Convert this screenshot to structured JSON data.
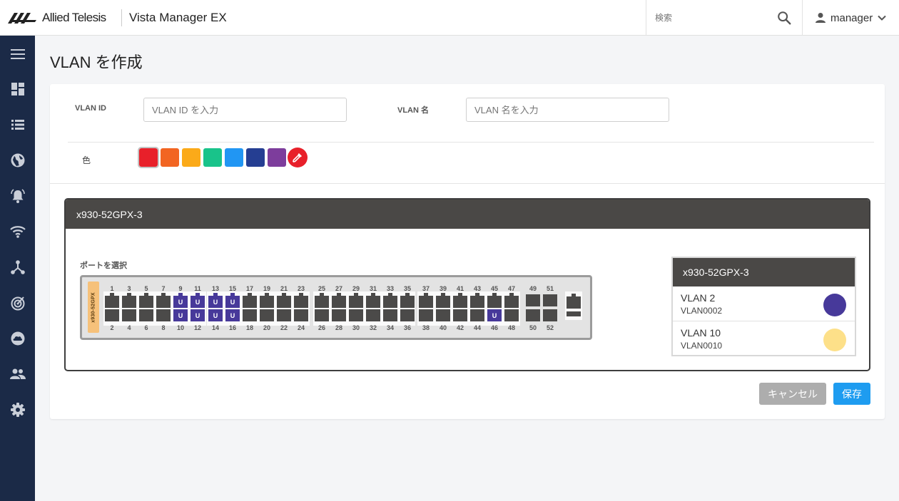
{
  "header": {
    "brand": "Allied Telesis",
    "app_title": "Vista Manager EX",
    "search_placeholder": "検索",
    "user": "manager"
  },
  "sidebar": {
    "items": [
      {
        "icon": "menu-icon"
      },
      {
        "icon": "dashboard-icon"
      },
      {
        "icon": "list-icon"
      },
      {
        "icon": "globe-icon"
      },
      {
        "icon": "alarm-icon"
      },
      {
        "icon": "wifi-icon"
      },
      {
        "icon": "topology-icon"
      },
      {
        "icon": "radar-icon"
      },
      {
        "icon": "cloud-icon"
      },
      {
        "icon": "users-icon"
      },
      {
        "icon": "gear-icon"
      }
    ]
  },
  "page": {
    "title": "VLAN を作成"
  },
  "form": {
    "vlan_id_label": "VLAN ID",
    "vlan_id_placeholder": "VLAN ID を入力",
    "vlan_name_label": "VLAN 名",
    "vlan_name_placeholder": "VLAN 名を入力",
    "color_label": "色",
    "colors": [
      "#e8202a",
      "#f26522",
      "#fbaa19",
      "#19c38a",
      "#2196f3",
      "#253e92",
      "#7d3d9c"
    ],
    "selected_color_index": 0
  },
  "device": {
    "name": "x930-52GPX-3",
    "port_select_label": "ポートを選択",
    "model": "x930-52GPX",
    "port_marker": "U",
    "top_numbers": [
      "1",
      "3",
      "5",
      "7",
      "9",
      "11",
      "13",
      "15",
      "17",
      "19",
      "21",
      "23",
      "25",
      "27",
      "29",
      "31",
      "33",
      "35",
      "37",
      "39",
      "41",
      "43",
      "45",
      "47"
    ],
    "bottom_numbers": [
      "2",
      "4",
      "6",
      "8",
      "10",
      "12",
      "14",
      "16",
      "18",
      "20",
      "22",
      "24",
      "26",
      "28",
      "30",
      "32",
      "34",
      "36",
      "38",
      "40",
      "42",
      "44",
      "46",
      "48"
    ],
    "sfp_top": [
      "49",
      "51"
    ],
    "sfp_bottom": [
      "50",
      "52"
    ],
    "vlan_ports": [
      "9",
      "10",
      "11",
      "12",
      "13",
      "14",
      "15",
      "16",
      "46"
    ]
  },
  "vlan_list": {
    "title": "x930-52GPX-3",
    "items": [
      {
        "name": "VLAN 2",
        "sub": "VLAN0002",
        "color": "#47399a"
      },
      {
        "name": "VLAN 10",
        "sub": "VLAN0010",
        "color": "#fde089"
      }
    ]
  },
  "buttons": {
    "cancel": "キャンセル",
    "save": "保存"
  }
}
